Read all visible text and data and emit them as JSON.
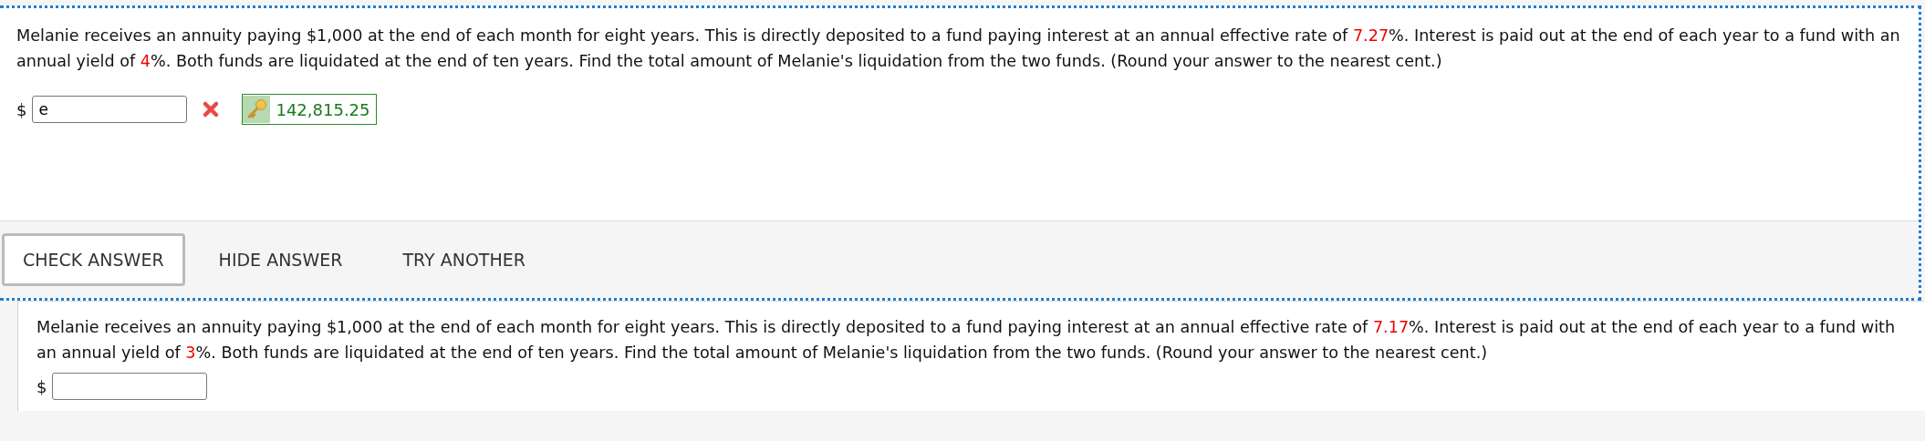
{
  "questions": [
    {
      "parts": [
        {
          "text": "Melanie receives an annuity paying $1,000 at the end of each month for eight years. This is directly deposited to a fund paying interest at an annual effective rate of ",
          "highlight": false
        },
        {
          "text": "7.27",
          "highlight": true
        },
        {
          "text": "%. Interest is paid out at the end of each year to a fund with an annual yield of ",
          "highlight": false
        },
        {
          "text": "4",
          "highlight": true
        },
        {
          "text": "%. Both funds are liquidated at the end of ten years. Find the total amount of Melanie's liquidation from the two funds. (Round your answer to the nearest cent.)",
          "highlight": false
        }
      ],
      "currency": "$",
      "value": "e",
      "incorrect": true,
      "answer": "142,815.25",
      "active": true,
      "buttons": [
        {
          "label": "CHECK ANSWER",
          "kind": "outlined"
        },
        {
          "label": "HIDE ANSWER",
          "kind": "plain"
        },
        {
          "label": "TRY ANOTHER",
          "kind": "plain"
        }
      ]
    },
    {
      "parts": [
        {
          "text": "Melanie receives an annuity paying $1,000 at the end of each month for eight years. This is directly deposited to a fund paying interest at an annual effective rate of ",
          "highlight": false
        },
        {
          "text": "7.17",
          "highlight": true
        },
        {
          "text": "%. Interest is paid out at the end of each year to a fund with an annual yield of ",
          "highlight": false
        },
        {
          "text": "3",
          "highlight": true
        },
        {
          "text": "%. Both funds are liquidated at the end of ten years. Find the total amount of Melanie's liquidation from the two funds. (Round your answer to the nearest cent.)",
          "highlight": false
        }
      ],
      "currency": "$",
      "active": false
    }
  ]
}
